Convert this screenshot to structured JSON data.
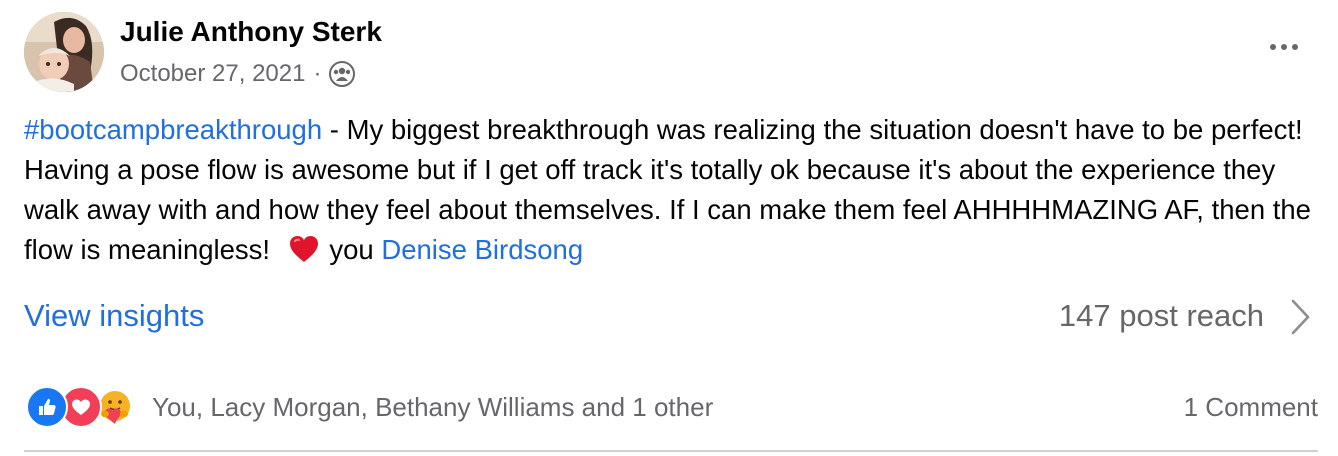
{
  "post": {
    "author": "Julie Anthony Sterk",
    "date": "October 27, 2021",
    "separator": "·",
    "hashtag": "#bootcampbreakthrough",
    "text_main": " - My biggest breakthrough was realizing the situation doesn't have to be perfect! Having a pose flow is awesome but if I get off track it's totally ok because it's about the experience they walk away with and how they feel about themselves. If I can make them feel AHHHHMAZING AF, then the flow is meaningless! ",
    "text_after_heart": " you ",
    "mention": "Denise Birdsong",
    "audience_icon": "friends-icon",
    "heart_icon": "red-heart-emoji"
  },
  "insights": {
    "label": "View insights",
    "reach": "147 post reach"
  },
  "engagement": {
    "reactions": [
      "like-icon",
      "love-icon",
      "care-icon"
    ],
    "reactors": "You, Lacy Morgan, Bethany Williams and 1 other",
    "comments": "1 Comment"
  },
  "colors": {
    "link": "#216fdb",
    "secondary_text": "#65676b",
    "like": "#1877f2",
    "love": "#f33e58",
    "divider": "#ced0d4"
  }
}
